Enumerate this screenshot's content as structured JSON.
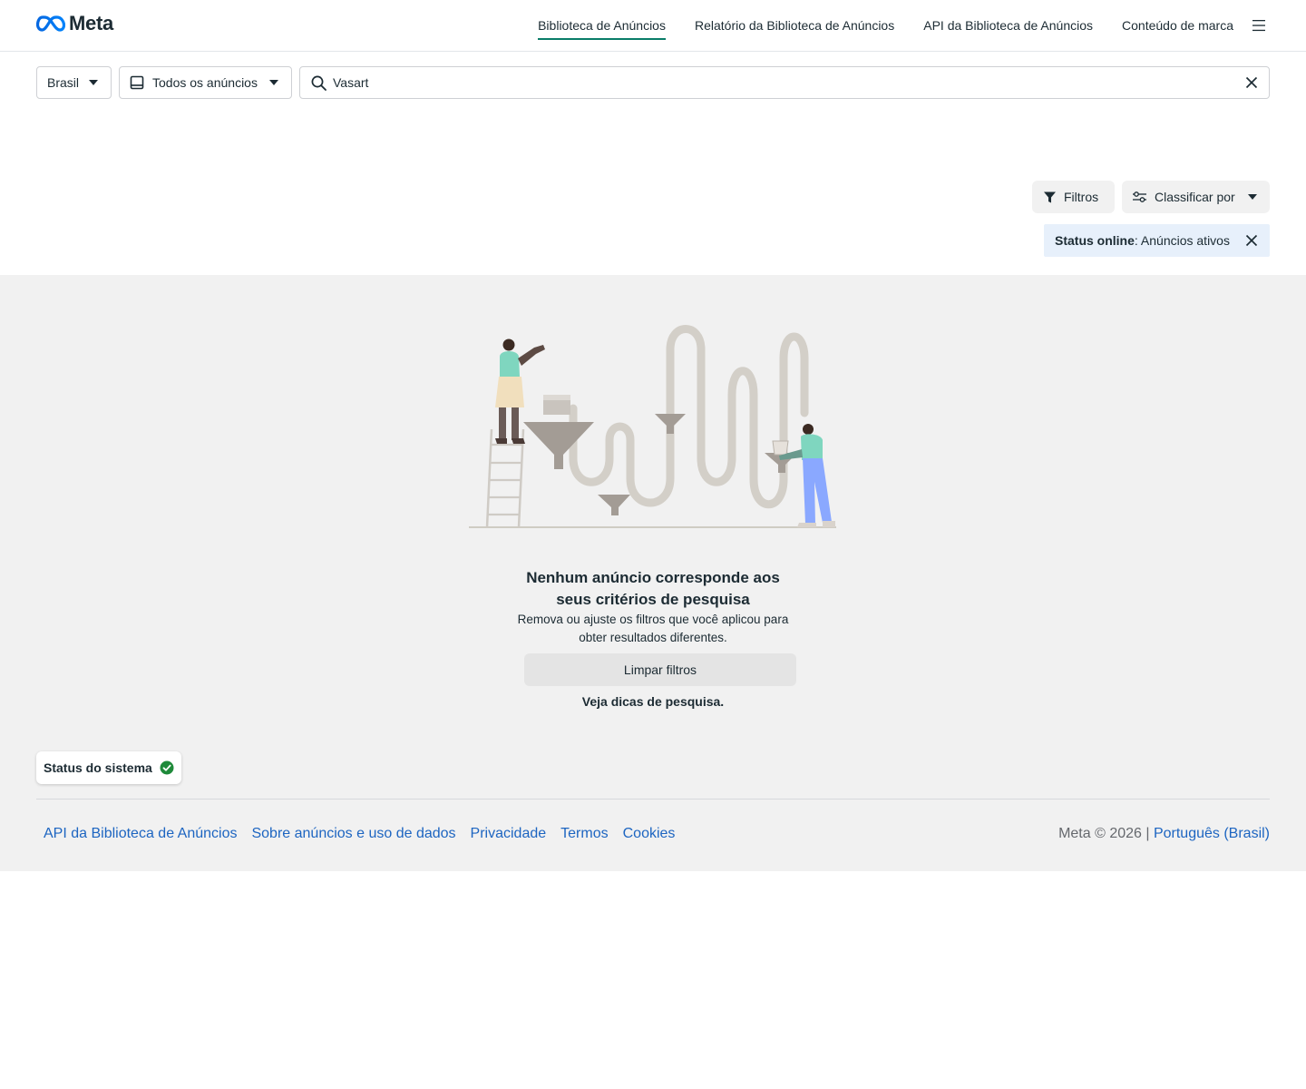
{
  "brand": {
    "logo_text": "Meta",
    "accent": "#0a7d68",
    "link_color": "#1d65c1"
  },
  "nav": {
    "items": [
      {
        "label": "Biblioteca de Anúncios",
        "active": true
      },
      {
        "label": "Relatório da Biblioteca de Anúncios",
        "active": false
      },
      {
        "label": "API da Biblioteca de Anúncios",
        "active": false
      },
      {
        "label": "Conteúdo de marca",
        "active": false
      }
    ],
    "menu_icon": "hamburger-icon"
  },
  "search": {
    "country": "Brasil",
    "ad_type": "Todos os anúncios",
    "query": "Vasart",
    "search_icon": "search-icon",
    "clear_icon": "close-icon"
  },
  "toolbar": {
    "filters_label": "Filtros",
    "sort_label": "Classificar por"
  },
  "active_filter": {
    "key": "Status online",
    "value": ": Anúncios ativos"
  },
  "empty_state": {
    "title": "Nenhum anúncio corresponde aos seus critérios de pesquisa",
    "text": "Remova ou ajuste os filtros que você aplicou para obter resultados diferentes.",
    "clear_button": "Limpar filtros",
    "tips_link": "Veja dicas de pesquisa."
  },
  "system_status": {
    "label": "Status do sistema",
    "ok_color": "#1f8a3a"
  },
  "footer": {
    "links": [
      "API da Biblioteca de Anúncios",
      "Sobre anúncios e uso de dados",
      "Privacidade",
      "Termos",
      "Cookies"
    ],
    "copyright": "Meta © 2026 | ",
    "language": "Português (Brasil)"
  }
}
